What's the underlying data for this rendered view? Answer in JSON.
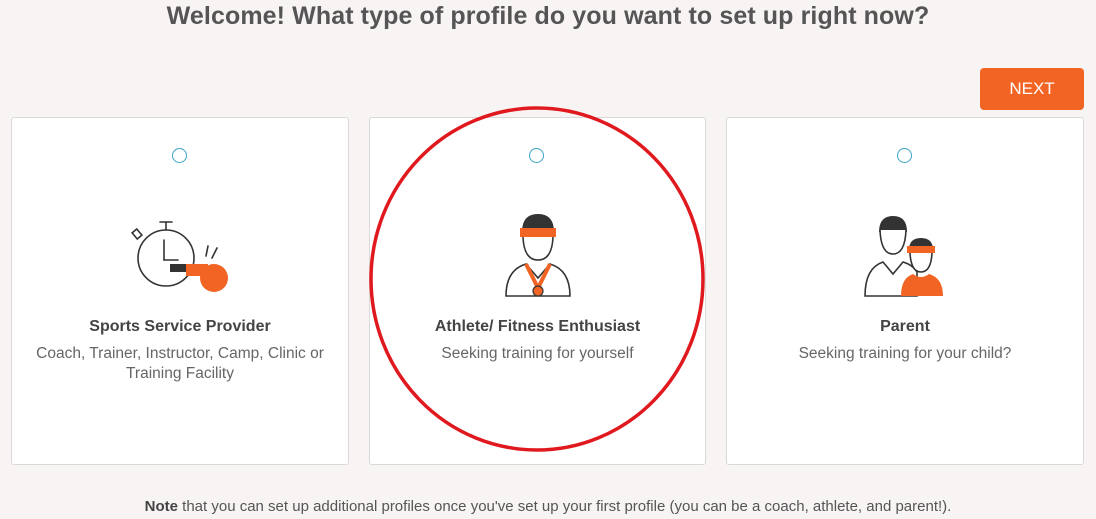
{
  "header": {
    "title": "Welcome! What type of profile do you want to set up right now?"
  },
  "actions": {
    "next_label": "NEXT"
  },
  "cards": [
    {
      "title": "Sports Service Provider",
      "description": "Coach, Trainer, Instructor, Camp, Clinic or Training Facility",
      "icon": "stopwatch-whistle-icon",
      "selected": false
    },
    {
      "title": "Athlete/ Fitness Enthusiast",
      "description": "Seeking training for yourself",
      "icon": "athlete-medal-icon",
      "selected": false
    },
    {
      "title": "Parent",
      "description": "Seeking training for your child?",
      "icon": "parent-child-icon",
      "selected": false
    }
  ],
  "footer": {
    "note_bold": "Note",
    "note_text": " that you can set up additional profiles once you've set up your first profile (you can be a coach, athlete, and parent!)."
  },
  "colors": {
    "accent": "#f26424",
    "radio": "#3aa3c3",
    "annotation": "#e0191f"
  }
}
